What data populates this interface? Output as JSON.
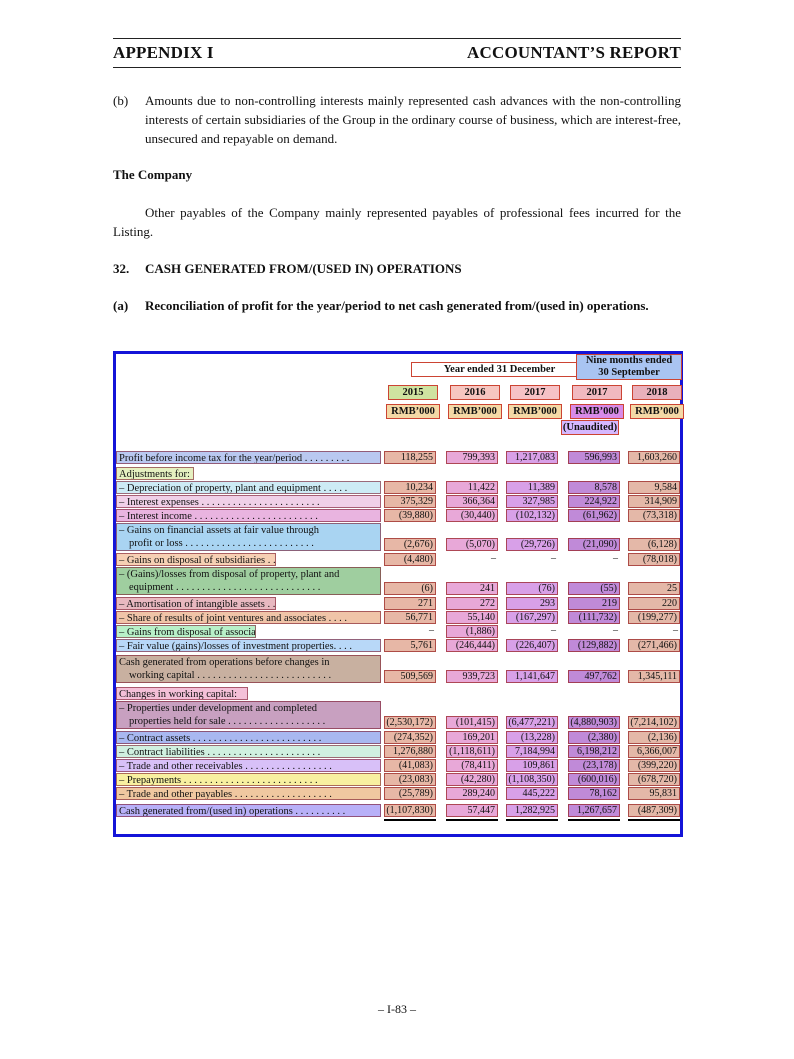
{
  "header": {
    "left": "APPENDIX I",
    "right": "ACCOUNTANT’S REPORT"
  },
  "para_b": {
    "label": "(b)",
    "text": "Amounts due to non-controlling interests mainly represented cash advances with the non-controlling interests of certain subsidiaries of the Group in the ordinary course of business, which are interest-free, unsecured and repayable on demand."
  },
  "company_heading": "The Company",
  "company_text": "Other payables of the Company mainly represented payables of professional fees incurred for the Listing.",
  "section32": {
    "num": "32.",
    "title": "CASH GENERATED FROM/(USED IN) OPERATIONS"
  },
  "section_a": {
    "label": "(a)",
    "title": "Reconciliation of profit for the year/period to net cash generated from/(used in) operations."
  },
  "table": {
    "group1": "Year ended 31 December",
    "group2_l1": "Nine months ended",
    "group2_l2": "30 September",
    "years": [
      "2015",
      "2016",
      "2017",
      "2017",
      "2018"
    ],
    "units": [
      "RMB’000",
      "RMB’000",
      "RMB’000",
      "RMB’000",
      "RMB’000"
    ],
    "unaudited": "(Unaudited)",
    "rows": [
      {
        "label": "Profit before income tax for the year/period . . . . . . . . .",
        "vals": [
          "118,255",
          "799,393",
          "1,217,083",
          "596,993",
          "1,603,260"
        ]
      },
      {
        "label": "Adjustments for:",
        "vals": [
          "",
          "",
          "",
          "",
          ""
        ]
      },
      {
        "label": "– Depreciation of property, plant and equipment . . . . .",
        "vals": [
          "10,234",
          "11,422",
          "11,389",
          "8,578",
          "9,584"
        ]
      },
      {
        "label": "– Interest expenses . . . . . . . . . . . . . . . . . . . . . . .",
        "vals": [
          "375,329",
          "366,364",
          "327,985",
          "224,922",
          "314,909"
        ]
      },
      {
        "label": "– Interest income . . . . . . . . . . . . . . . . . . . . . . . .",
        "vals": [
          "(39,880)",
          "(30,440)",
          "(102,132)",
          "(61,962)",
          "(73,318)"
        ]
      },
      {
        "label": "– Gains on financial assets at fair value through",
        "label2": "profit or loss . . . . . . . . . . . . . . . . . . . . . . . . .",
        "vals": [
          "(2,676)",
          "(5,070)",
          "(29,726)",
          "(21,090)",
          "(6,128)"
        ]
      },
      {
        "label": "– Gains on disposal of subsidiaries . . . . . . . . . . . . . .",
        "vals": [
          "(4,480)",
          "–",
          "–",
          "–",
          "(78,018)"
        ]
      },
      {
        "label": "– (Gains)/losses from disposal of property, plant and",
        "label2": "equipment . . . . . . . . . . . . . . . . . . . . . . . . . . . .",
        "vals": [
          "(6)",
          "241",
          "(76)",
          "(55)",
          "25"
        ]
      },
      {
        "label": "– Amortisation of intangible assets . . . . . . . . . . . . . .",
        "vals": [
          "271",
          "272",
          "293",
          "219",
          "220"
        ]
      },
      {
        "label": "– Share of results of joint ventures and associates . . . .",
        "vals": [
          "56,771",
          "55,140",
          "(167,297)",
          "(111,732)",
          "(199,277)"
        ]
      },
      {
        "label": "– Gains from disposal of associates . . . . . . . . . . . . . .",
        "vals": [
          "–",
          "(1,886)",
          "–",
          "–",
          "–"
        ]
      },
      {
        "label": "– Fair value (gains)/losses of investment properties. . . .",
        "vals": [
          "5,761",
          "(246,444)",
          "(226,407)",
          "(129,882)",
          "(271,466)"
        ]
      },
      {
        "label": "Cash generated from operations before changes in",
        "label2": "working capital . . . . . . . . . . . . . . . . . . . . . . . . . .",
        "vals": [
          "509,569",
          "939,723",
          "1,141,647",
          "497,762",
          "1,345,111"
        ]
      },
      {
        "label": "Changes in working capital:",
        "vals": [
          "",
          "",
          "",
          "",
          ""
        ]
      },
      {
        "label": "– Properties under development and completed",
        "label2": "properties held for sale . . . . . . . . . . . . . . . . . . .",
        "vals": [
          "(2,530,172)",
          "(101,415)",
          "(6,477,221)",
          "(4,880,903)",
          "(7,214,102)"
        ]
      },
      {
        "label": "– Contract assets . . . . . . . . . . . . . . . . . . . . . . . . .",
        "vals": [
          "(274,352)",
          "169,201",
          "(13,228)",
          "(2,380)",
          "(2,136)"
        ]
      },
      {
        "label": "– Contract liabilities . . . . . . . . . . . . . . . . . . . . . .",
        "vals": [
          "1,276,880",
          "(1,118,611)",
          "7,184,994",
          "6,198,212",
          "6,366,007"
        ]
      },
      {
        "label": "– Trade and other receivables . . . . . . . . . . . . . . . . .",
        "vals": [
          "(41,083)",
          "(78,411)",
          "109,861",
          "(23,178)",
          "(399,220)"
        ]
      },
      {
        "label": "– Prepayments . . . . . . . . . . . . . . . . . . . . . . . . . .",
        "vals": [
          "(23,083)",
          "(42,280)",
          "(1,108,350)",
          "(600,016)",
          "(678,720)"
        ]
      },
      {
        "label": "– Trade and other payables . . . . . . . . . . . . . . . . . . .",
        "vals": [
          "(25,789)",
          "289,240",
          "445,222",
          "78,162",
          "95,831"
        ]
      },
      {
        "label": "Cash generated from/(used in) operations . . . . . . . . . .",
        "vals": [
          "(1,107,830)",
          "57,447",
          "1,282,925",
          "1,267,657",
          "(487,309)"
        ]
      }
    ]
  },
  "footer": "– I-83 –"
}
